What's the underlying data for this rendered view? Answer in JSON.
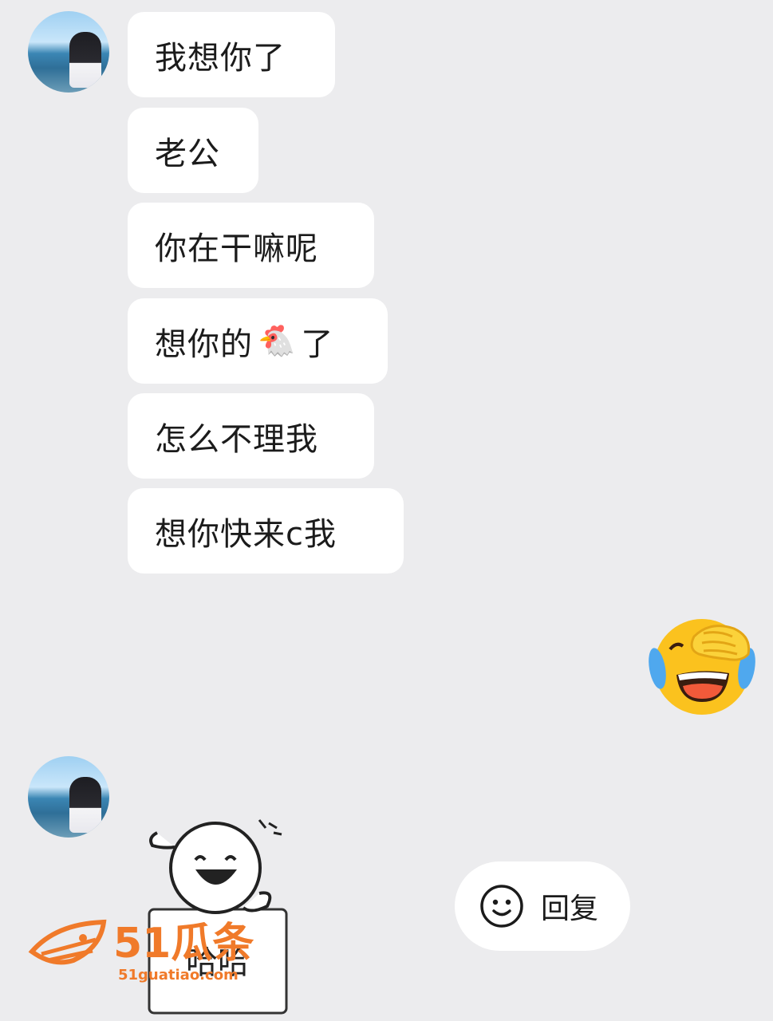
{
  "chat": {
    "messages": [
      {
        "sender": "other",
        "text": "我想你了"
      },
      {
        "sender": "other",
        "text": "老公"
      },
      {
        "sender": "other",
        "text": "你在干嘛呢"
      },
      {
        "sender": "other",
        "text_before": "想你的",
        "emoji": "🐔",
        "text_after": "了"
      },
      {
        "sender": "other",
        "text": "怎么不理我"
      },
      {
        "sender": "other",
        "text": "想你快来c我"
      }
    ],
    "self_emoji_reply": "face-palm-laughing-crying-emoji",
    "sticker_text": "哈哈"
  },
  "reply_button": {
    "icon": "smile-icon",
    "label": "回复"
  },
  "watermark": {
    "brand": "51瓜条",
    "url": "51guatiao.com",
    "color": "#f07a2a"
  }
}
